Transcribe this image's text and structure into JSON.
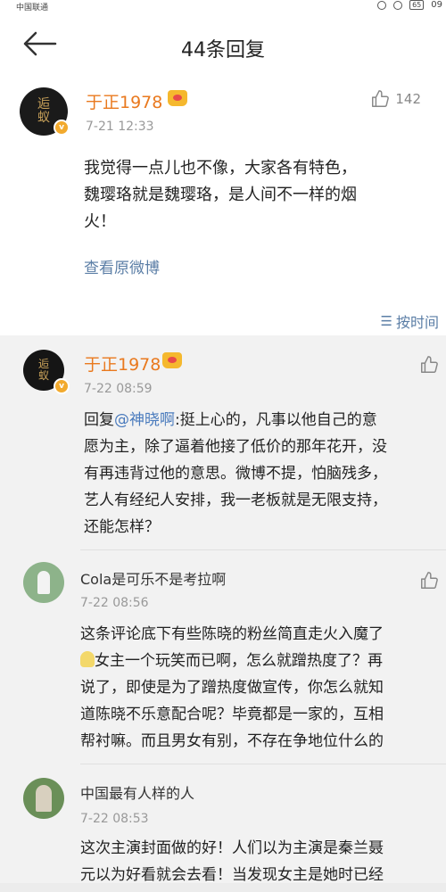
{
  "status_bar": {
    "carrier": "中国联通",
    "time": "09",
    "battery": "65"
  },
  "header": {
    "title": "44条回复",
    "back_icon": "arrow-left-icon"
  },
  "main_comment": {
    "user": "于正1978",
    "time": "7-21 12:33",
    "likes": "142",
    "text_lines": [
      "我觉得一点儿也不像，大家各有特色，",
      "魏璎珞就是魏璎珞，是人间不一样的烟",
      "火！"
    ],
    "view_original": "查看原微博"
  },
  "sort_label": "按时间",
  "replies": [
    {
      "user": "于正1978",
      "time": "7-22 08:59",
      "reply_prefix": "回复",
      "mention": "@神晓啊",
      "text_lines": [
        ":挺上心的，凡事以他自己的意",
        "愿为主，除了逼着他接了低价的那年花开，没",
        "有再违背过他的意思。微博不提，怕脑残多，",
        "艺人有经纪人安排，我一老板就是无限支持，",
        "还能怎样？"
      ]
    },
    {
      "user": "Cola是可乐不是考拉啊",
      "time": "7-22 08:56",
      "text_lines": [
        "这条评论底下有些陈晓的粉丝简直走火入魔了",
        "女主一个玩笑而已啊，怎么就蹭热度了？再",
        "说了，即使是为了蹭热度做宣传，你怎么就知",
        "道陈晓不乐意配合呢？毕竟都是一家的，互相",
        "帮衬嘛。而且男女有别，不存在争地位什么的"
      ]
    },
    {
      "user": "中国最有人样的人",
      "time": "7-22 08:53",
      "text_lines": [
        "这次主演封面做的好！人们以为主演是秦兰聂",
        "元以为好看就会去看！当发现女主是她时已经"
      ]
    }
  ],
  "colors": {
    "username_vip": "#e9791e",
    "link": "#4a7bbd",
    "time": "#999999"
  }
}
